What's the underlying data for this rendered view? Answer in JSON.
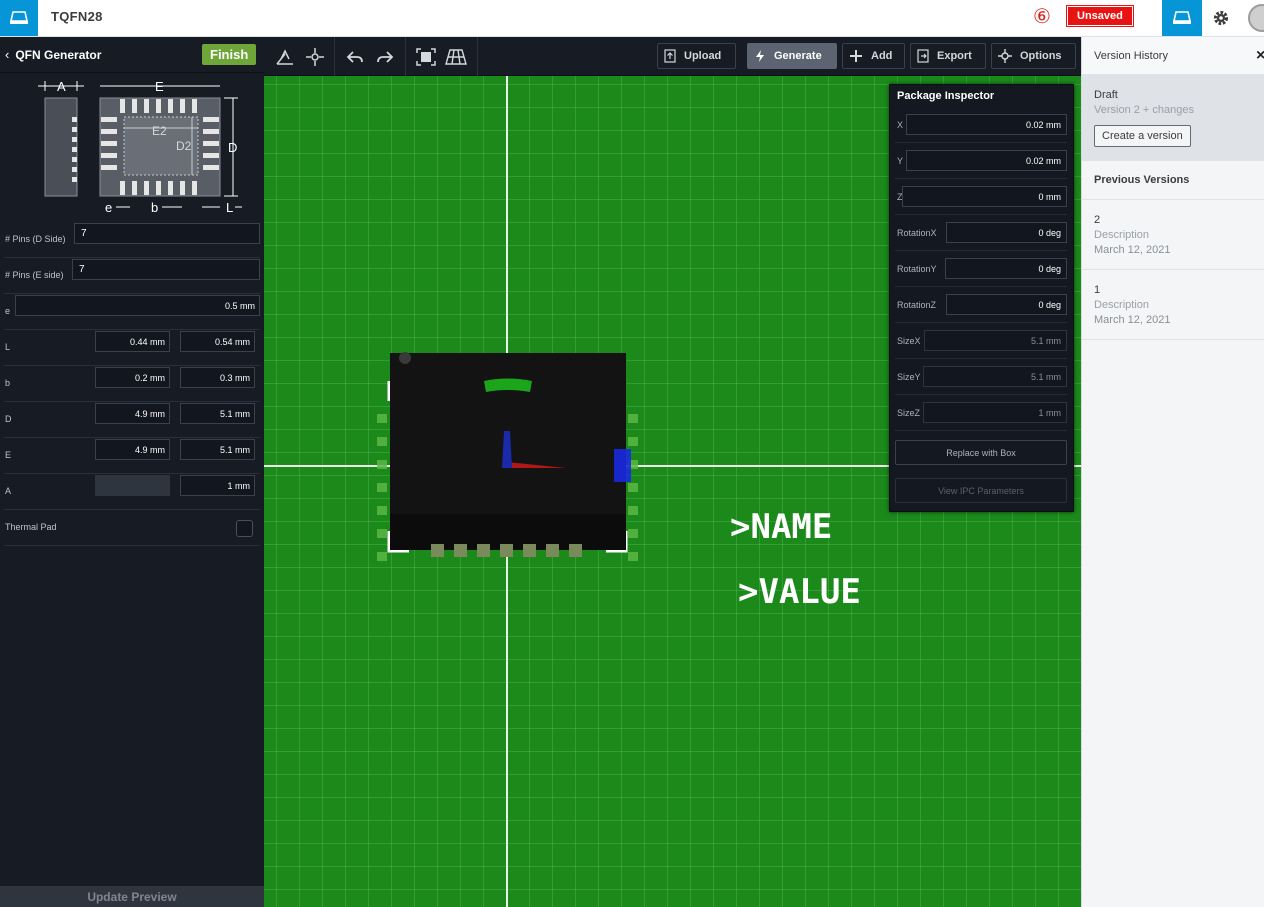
{
  "app": {
    "document_title": "TQFN28",
    "save_count": "⑥",
    "status_badge": "Unsaved"
  },
  "left_panel": {
    "back_icon": "chevron-left-icon",
    "title": "QFN Generator",
    "finish_label": "Finish",
    "diagram_labels": {
      "A": "A",
      "E": "E",
      "E2": "E2",
      "D2": "D2",
      "D": "D",
      "e": "e",
      "b": "b",
      "L": "L"
    },
    "fields": {
      "pins_d": {
        "label": "# Pins (D Side)",
        "value": "7"
      },
      "pins_e": {
        "label": "# Pins (E side)",
        "value": "7"
      },
      "e": {
        "label": "e",
        "value": "0.5 mm"
      },
      "L": {
        "label": "L",
        "min": "0.44 mm",
        "max": "0.54 mm"
      },
      "b": {
        "label": "b",
        "min": "0.2 mm",
        "max": "0.3 mm"
      },
      "D": {
        "label": "D",
        "min": "4.9 mm",
        "max": "5.1 mm"
      },
      "E": {
        "label": "E",
        "min": "4.9 mm",
        "max": "5.1 mm"
      },
      "A": {
        "label": "A",
        "min": "",
        "max": "1 mm"
      },
      "thermal_pad": {
        "label": "Thermal Pad",
        "checked": false
      }
    },
    "update_preview_label": "Update Preview"
  },
  "toolbar": {
    "tools": [
      "snap-icon",
      "origin-icon",
      "undo-icon",
      "redo-icon",
      "fit-view-icon",
      "grid-view-icon"
    ],
    "upload_label": "Upload",
    "generate_label": "Generate",
    "add_label": "Add",
    "export_label": "Export",
    "options_label": "Options"
  },
  "canvas": {
    "name_text": ">NAME",
    "value_text": ">VALUE",
    "grid_color": "#1b8a1b"
  },
  "inspector": {
    "title": "Package Inspector",
    "rows": [
      {
        "label": "X",
        "value": "0.02 mm"
      },
      {
        "label": "Y",
        "value": "0.02 mm"
      },
      {
        "label": "Z",
        "value": "0 mm"
      },
      {
        "label": "RotationX",
        "value": "0 deg"
      },
      {
        "label": "RotationY",
        "value": "0 deg"
      },
      {
        "label": "RotationZ",
        "value": "0 deg"
      },
      {
        "label": "SizeX",
        "value": "5.1 mm"
      },
      {
        "label": "SizeY",
        "value": "5.1 mm"
      },
      {
        "label": "SizeZ",
        "value": "1 mm"
      }
    ],
    "replace_label": "Replace with Box",
    "view_ipc_label": "View IPC Parameters"
  },
  "version_history": {
    "title": "Version History",
    "close_label": "×",
    "draft_title": "Draft",
    "draft_sub": "Version 2 + changes",
    "create_label": "Create a version",
    "previous_title": "Previous Versions",
    "versions": [
      {
        "number": "2",
        "description": "Description",
        "date": "March 12, 2021"
      },
      {
        "number": "1",
        "description": "Description",
        "date": "March 12, 2021"
      }
    ]
  },
  "colors": {
    "accent": "#0696d7",
    "finish": "#6ea63a",
    "unsaved": "#e81414"
  }
}
